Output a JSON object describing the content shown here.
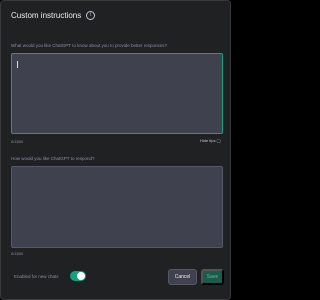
{
  "dialog": {
    "title": "Custom instructions",
    "info_icon": "info-icon"
  },
  "fields": [
    {
      "label": "What would you like ChatGPT to know about you to provide better responses?",
      "value": "",
      "counter": "0/1500"
    },
    {
      "label": "How would you like ChatGPT to respond?",
      "value": "",
      "counter": "0/1500"
    }
  ],
  "tips": {
    "label": "Hide tips",
    "icon": "tips-icon"
  },
  "footer": {
    "enabled_label": "Enabled for new chats",
    "enabled": true,
    "cancel_label": "Cancel",
    "save_label": "Save"
  },
  "colors": {
    "background": "#202123",
    "input_background": "#40414f",
    "accent": "#10a37f",
    "save_disabled": "#1a5c4a"
  }
}
